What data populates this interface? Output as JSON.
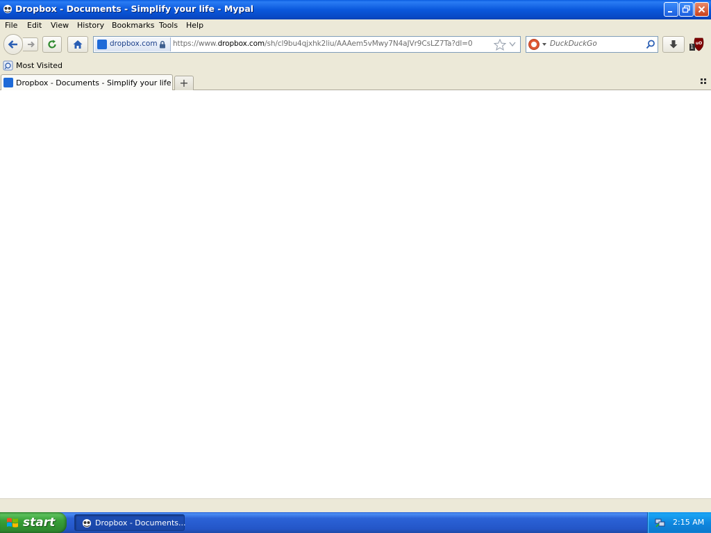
{
  "window": {
    "title": "Dropbox - Documents - Simplify your life - Mypal"
  },
  "menu": {
    "items": [
      "File",
      "Edit",
      "View",
      "History",
      "Bookmarks",
      "Tools",
      "Help"
    ]
  },
  "navbar": {
    "site_identity": "dropbox.com",
    "url_prefix": "https://www.",
    "url_domain": "dropbox.com",
    "url_path": "/sh/cl9bu4qjxhk2liu/AAAem5vMwy7N4aJVr9CsLZ7Ta?dl=0",
    "search_placeholder": "DuckDuckGo",
    "ublock_badge": "1"
  },
  "bookmarks": {
    "most_visited": "Most Visited"
  },
  "tabs": [
    {
      "title": "Dropbox - Documents - Simplify your life",
      "active": true
    }
  ],
  "new_tab_symbol": "+",
  "taskbar": {
    "start_label": "start",
    "task_item": "Dropbox - Documents...",
    "clock": "2:15 AM"
  },
  "colors": {
    "titlebar": "#0a58dc",
    "chrome": "#ece9d8",
    "start_green": "#38a038",
    "dropbox_blue": "#1e6ad8"
  }
}
